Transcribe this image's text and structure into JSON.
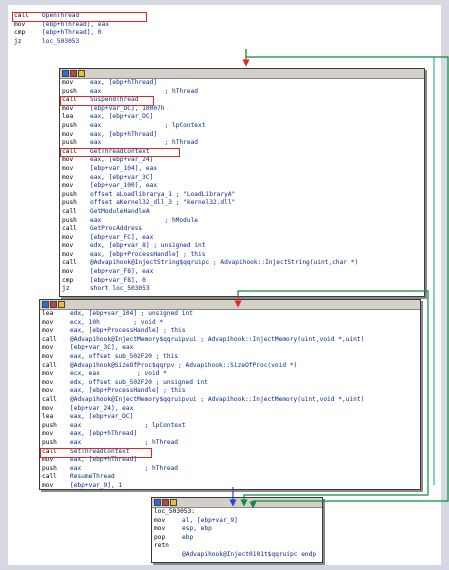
{
  "colors": {
    "highlight": "#e0281e",
    "edge_green": "#0b8f3a",
    "edge_red": "#e0281e",
    "edge_blue": "#2b44c8",
    "edge_teal": "#2aa6a6",
    "operand": "#0a2a88"
  },
  "icons": {
    "header": [
      "graph-icon",
      "stop-icon",
      "comment-icon"
    ]
  },
  "block1": {
    "lines": [
      {
        "m": "call",
        "o": "OpenThread"
      },
      {
        "m": "mov",
        "o": "[ebp+hThread], eax"
      },
      {
        "m": "cmp",
        "o": "[ebp+hThread], 0"
      },
      {
        "m": "jz",
        "o": "loc_503053"
      }
    ]
  },
  "block2": {
    "lines": [
      {
        "m": "mov",
        "o": "eax, [ebp+hThread]"
      },
      {
        "m": "push",
        "o": "eax                 ; hThread"
      },
      {
        "m": "call",
        "o": "SuspendThread"
      },
      {
        "m": "mov",
        "o": "[ebp+var_DC], 10007h"
      },
      {
        "m": "lea",
        "o": "eax, [ebp+var_DC]"
      },
      {
        "m": "push",
        "o": "eax                 ; lpContext"
      },
      {
        "m": "mov",
        "o": "eax, [ebp+hThread]"
      },
      {
        "m": "push",
        "o": "eax                 ; hThread"
      },
      {
        "m": "call",
        "o": "GetThreadContext"
      },
      {
        "m": "mov",
        "o": "eax, [ebp+var_24]"
      },
      {
        "m": "mov",
        "o": "[ebp+var_104], eax"
      },
      {
        "m": "mov",
        "o": "eax, [ebp+var_3C]"
      },
      {
        "m": "mov",
        "o": "[ebp+var_100], eax"
      },
      {
        "m": "push",
        "o": "offset aLoadlibrarya_1 ; \"LoadLibraryA\""
      },
      {
        "m": "push",
        "o": "offset aKernel32_dll_3 ; \"kernel32.dll\""
      },
      {
        "m": "call",
        "o": "GetModuleHandleA"
      },
      {
        "m": "push",
        "o": "eax                 ; hModule"
      },
      {
        "m": "call",
        "o": "GetProcAddress"
      },
      {
        "m": "mov",
        "o": "[ebp+var_FC], eax"
      },
      {
        "m": "mov",
        "o": "edx, [ebp+var_8] ; unsigned int"
      },
      {
        "m": "mov",
        "o": "eax, [ebp+ProcessHandle] ; this"
      },
      {
        "m": "call",
        "o": "@Advapihook@InjectString$qqruipc ; Advapihook::InjectString(uint,char *)"
      },
      {
        "m": "mov",
        "o": "[ebp+var_F8], eax"
      },
      {
        "m": "cmp",
        "o": "[ebp+var_F8], 0"
      },
      {
        "m": "jz",
        "o": "short loc_503053"
      }
    ]
  },
  "block3": {
    "lines": [
      {
        "m": "lea",
        "o": "edx, [ebp+var_104] ; unsigned int"
      },
      {
        "m": "mov",
        "o": "ecx, 10h         ; void *"
      },
      {
        "m": "mov",
        "o": "eax, [ebp+ProcessHandle] ; this"
      },
      {
        "m": "call",
        "o": "@Advapihook@InjectMemory$qqruipvui ; Advapihook::InjectMemory(uint,void *,uint)"
      },
      {
        "m": "mov",
        "o": "[ebp+var_3C], eax"
      },
      {
        "m": "mov",
        "o": "eax, offset sub_502F20 ; this"
      },
      {
        "m": "call",
        "o": "@Advapihook@SizeOfProc$qqrpv ; Advapihook::SizeOfProc(void *)"
      },
      {
        "m": "mov",
        "o": "ecx, eax          ; void *"
      },
      {
        "m": "mov",
        "o": "edx, offset sub_502F20 ; unsigned int"
      },
      {
        "m": "mov",
        "o": "eax, [ebp+ProcessHandle] ; this"
      },
      {
        "m": "call",
        "o": "@Advapihook@InjectMemory$qqruipvui ; Advapihook::InjectMemory(uint,void *,uint)"
      },
      {
        "m": "mov",
        "o": "[ebp+var_24], eax"
      },
      {
        "m": "lea",
        "o": "eax, [ebp+var_DC]"
      },
      {
        "m": "push",
        "o": "eax                 ; lpContext"
      },
      {
        "m": "mov",
        "o": "eax, [ebp+hThread]"
      },
      {
        "m": "push",
        "o": "eax                 ; hThread"
      },
      {
        "m": "call",
        "o": "SetThreadContext"
      },
      {
        "m": "mov",
        "o": "eax, [ebp+hThread]"
      },
      {
        "m": "push",
        "o": "eax                 ; hThread"
      },
      {
        "m": "call",
        "o": "ResumeThread"
      },
      {
        "m": "mov",
        "o": "[ebp+var_9], 1"
      }
    ]
  },
  "block4": {
    "label": "loc_503053:",
    "lines": [
      {
        "m": "mov",
        "o": "al, [ebp+var_9]"
      },
      {
        "m": "mov",
        "o": "esp, ebp"
      },
      {
        "m": "pop",
        "o": "ebp"
      },
      {
        "m": "retn",
        "o": ""
      },
      {
        "m": "",
        "o": "@Advapihook@Inject0101t$qqruipc endp"
      }
    ]
  }
}
